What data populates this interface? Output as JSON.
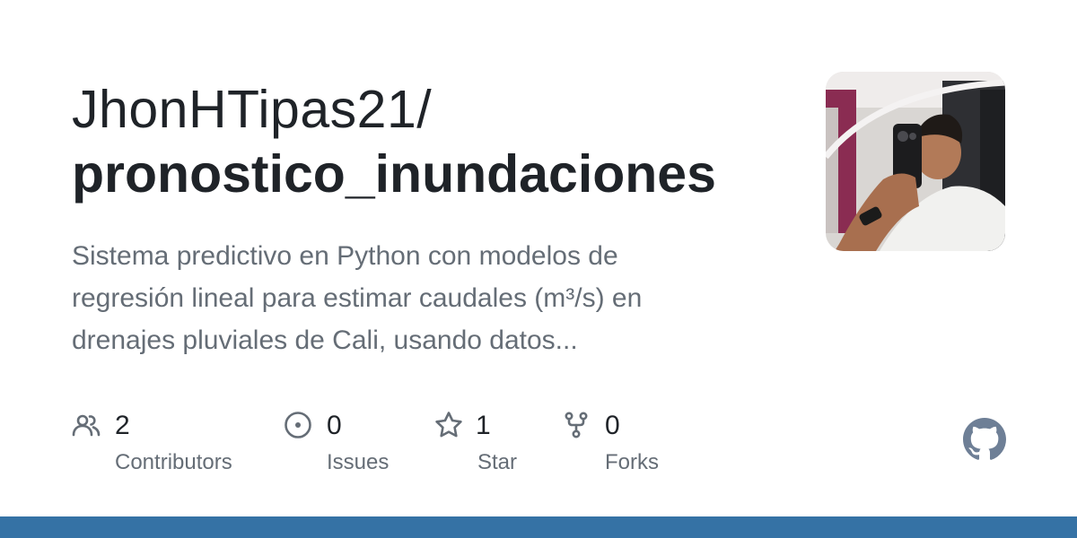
{
  "repo": {
    "owner": "JhonHTipas21/",
    "name": "pronostico_inundaciones",
    "description_lines": [
      "Sistema predictivo en Python con modelos de",
      "regresión lineal para estimar caudales (m³/s) en",
      "drenajes pluviales de Cali, usando datos..."
    ]
  },
  "stats": [
    {
      "icon": "people-icon",
      "value": "2",
      "label": "Contributors"
    },
    {
      "icon": "issue-opened-icon",
      "value": "0",
      "label": "Issues"
    },
    {
      "icon": "star-icon",
      "value": "1",
      "label": "Star"
    },
    {
      "icon": "repo-forked-icon",
      "value": "0",
      "label": "Forks"
    }
  ],
  "colors": {
    "bottom_bar": "#3572A5",
    "icon": "#656d76",
    "text_primary": "#1f2328",
    "text_secondary": "#656d76",
    "github_logo": "#6e7f96"
  },
  "avatar": {
    "icon": "avatar-photo"
  },
  "logo": {
    "icon": "github-mark-icon"
  }
}
